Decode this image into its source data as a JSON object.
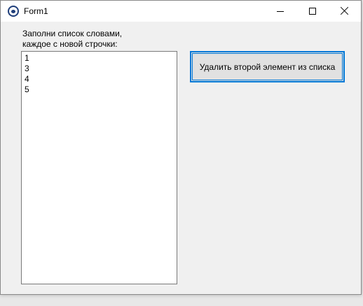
{
  "window": {
    "title": "Form1",
    "icon": "paw-icon",
    "controls": {
      "minimize": "minimize-icon",
      "maximize": "maximize-icon",
      "close": "close-icon"
    }
  },
  "form": {
    "prompt": "Заполни список словами,\nкаждое с новой строчки:",
    "list_lines": [
      "1",
      "3",
      "4",
      "5"
    ],
    "button_label": "Удалить второй элемент из списка"
  },
  "colors": {
    "accent": "#0078d7",
    "titlebar": "#ffffff",
    "window_bg": "#f0f0f0",
    "button_bg": "#e1e1e1"
  }
}
